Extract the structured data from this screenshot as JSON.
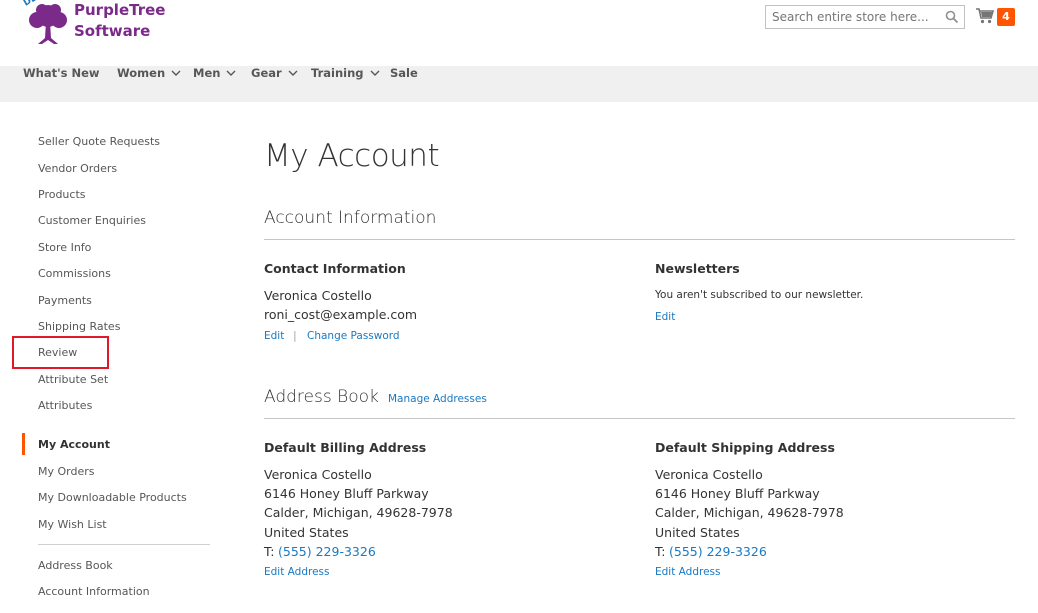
{
  "header": {
    "logo_demo": "DEMO",
    "logo_line1": "PurpleTree",
    "logo_line2": "Software",
    "search_placeholder": "Search entire store here...",
    "cart_count": "4"
  },
  "nav": {
    "items": [
      {
        "label": "What's New",
        "dropdown": false
      },
      {
        "label": "Women",
        "dropdown": true
      },
      {
        "label": "Men",
        "dropdown": true
      },
      {
        "label": "Gear",
        "dropdown": true
      },
      {
        "label": "Training",
        "dropdown": true
      },
      {
        "label": "Sale",
        "dropdown": false
      }
    ]
  },
  "sidebar": {
    "seller_links": [
      "Seller Quote Requests",
      "Vendor Orders",
      "Products",
      "Customer Enquiries",
      "Store Info",
      "Commissions",
      "Payments",
      "Shipping Rates",
      "Review",
      "Attribute Set",
      "Attributes"
    ],
    "account_links": [
      "My Account",
      "My Orders",
      "My Downloadable Products",
      "My Wish List"
    ],
    "extra_links": [
      "Address Book",
      "Account Information"
    ],
    "active_item": "My Account"
  },
  "main": {
    "page_title": "My Account",
    "account_info": {
      "title": "Account Information",
      "contact": {
        "title": "Contact Information",
        "name": "Veronica Costello",
        "email": "roni_cost@example.com",
        "edit_label": "Edit",
        "separator": "|",
        "change_password_label": "Change Password"
      },
      "newsletters": {
        "title": "Newsletters",
        "text": "You aren't subscribed to our newsletter.",
        "edit_label": "Edit"
      }
    },
    "address_book": {
      "title": "Address Book",
      "manage_label": "Manage Addresses",
      "billing": {
        "title": "Default Billing Address",
        "name": "Veronica Costello",
        "street": "6146 Honey Bluff Parkway",
        "city": "Calder, Michigan, 49628-7978",
        "country": "United States",
        "phone_prefix": "T:",
        "phone": "(555) 229-3326",
        "edit_label": "Edit Address"
      },
      "shipping": {
        "title": "Default Shipping Address",
        "name": "Veronica Costello",
        "street": "6146 Honey Bluff Parkway",
        "city": "Calder, Michigan, 49628-7978",
        "country": "United States",
        "phone_prefix": "T:",
        "phone": "(555) 229-3326",
        "edit_label": "Edit Address"
      }
    }
  },
  "colors": {
    "accent": "#ff5501",
    "link": "#1979c3",
    "brand": "#7b2a8a",
    "highlight": "#e0192a",
    "nav_bg": "#f0f0f0"
  }
}
